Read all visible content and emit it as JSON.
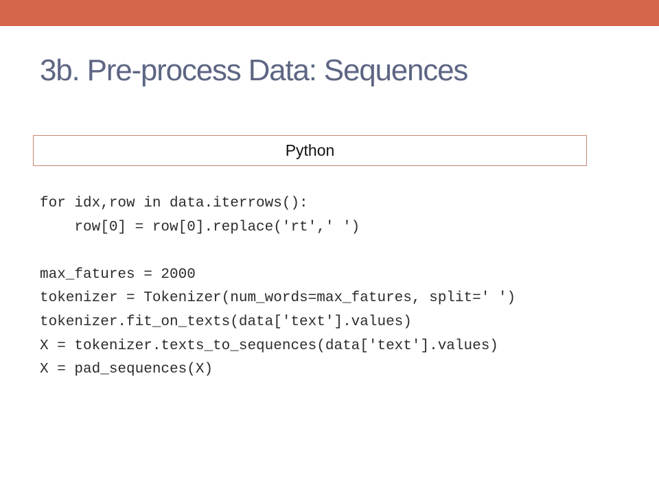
{
  "slide": {
    "title": "3b. Pre-process Data:  Sequences",
    "code_label": "Python",
    "code_lines": [
      "for idx,row in data.iterrows():",
      "    row[0] = row[0].replace('rt',' ')",
      "",
      "max_fatures = 2000",
      "tokenizer = Tokenizer(num_words=max_fatures, split=' ')",
      "tokenizer.fit_on_texts(data['text'].values)",
      "X = tokenizer.texts_to_sequences(data['text'].values)",
      "X = pad_sequences(X)"
    ]
  },
  "colors": {
    "accent_bar": "#d5664c",
    "title": "#5d6683",
    "box_border": "#c8836f"
  }
}
